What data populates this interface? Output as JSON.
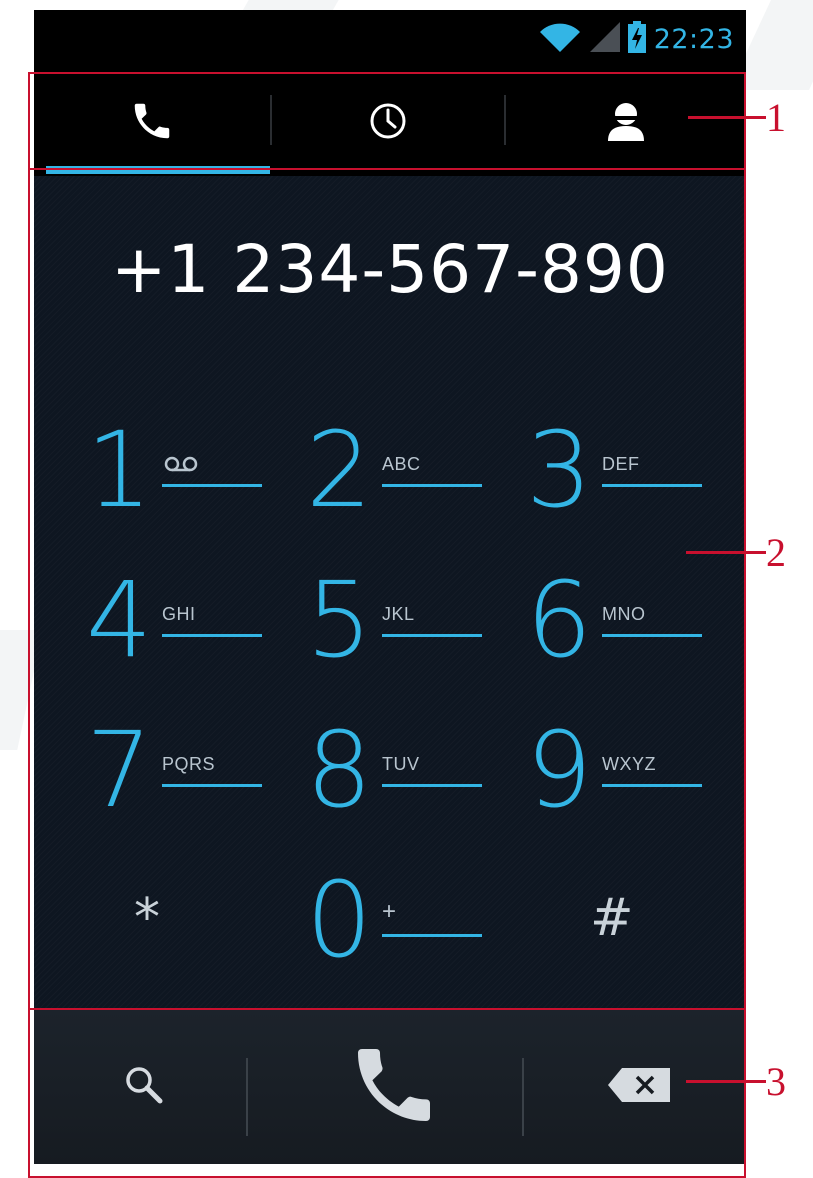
{
  "status_bar": {
    "time": "22:23",
    "icons": [
      "wifi-icon",
      "signal-icon",
      "battery-charging-icon"
    ]
  },
  "tabs": [
    {
      "icon": "phone-icon",
      "name": "dialer",
      "active": true
    },
    {
      "icon": "clock-icon",
      "name": "call-log",
      "active": false
    },
    {
      "icon": "contact-icon",
      "name": "contacts",
      "active": false
    }
  ],
  "dialer": {
    "number": "+1 234-567-890",
    "keys": [
      {
        "digit": "1",
        "letters": ""
      },
      {
        "digit": "2",
        "letters": "ABC"
      },
      {
        "digit": "3",
        "letters": "DEF"
      },
      {
        "digit": "4",
        "letters": "GHI"
      },
      {
        "digit": "5",
        "letters": "JKL"
      },
      {
        "digit": "6",
        "letters": "MNO"
      },
      {
        "digit": "7",
        "letters": "PQRS"
      },
      {
        "digit": "8",
        "letters": "TUV"
      },
      {
        "digit": "9",
        "letters": "WXYZ"
      },
      {
        "digit": "*",
        "letters": ""
      },
      {
        "digit": "0",
        "letters": "+"
      },
      {
        "digit": "#",
        "letters": ""
      }
    ]
  },
  "actions": {
    "icons": [
      "search-icon",
      "call-icon",
      "backspace-icon"
    ]
  },
  "annotations": {
    "labels": [
      "1",
      "2",
      "3"
    ]
  },
  "colors": {
    "accent": "#33b5e5",
    "callout": "#c8102e",
    "background": "#0e1621"
  }
}
